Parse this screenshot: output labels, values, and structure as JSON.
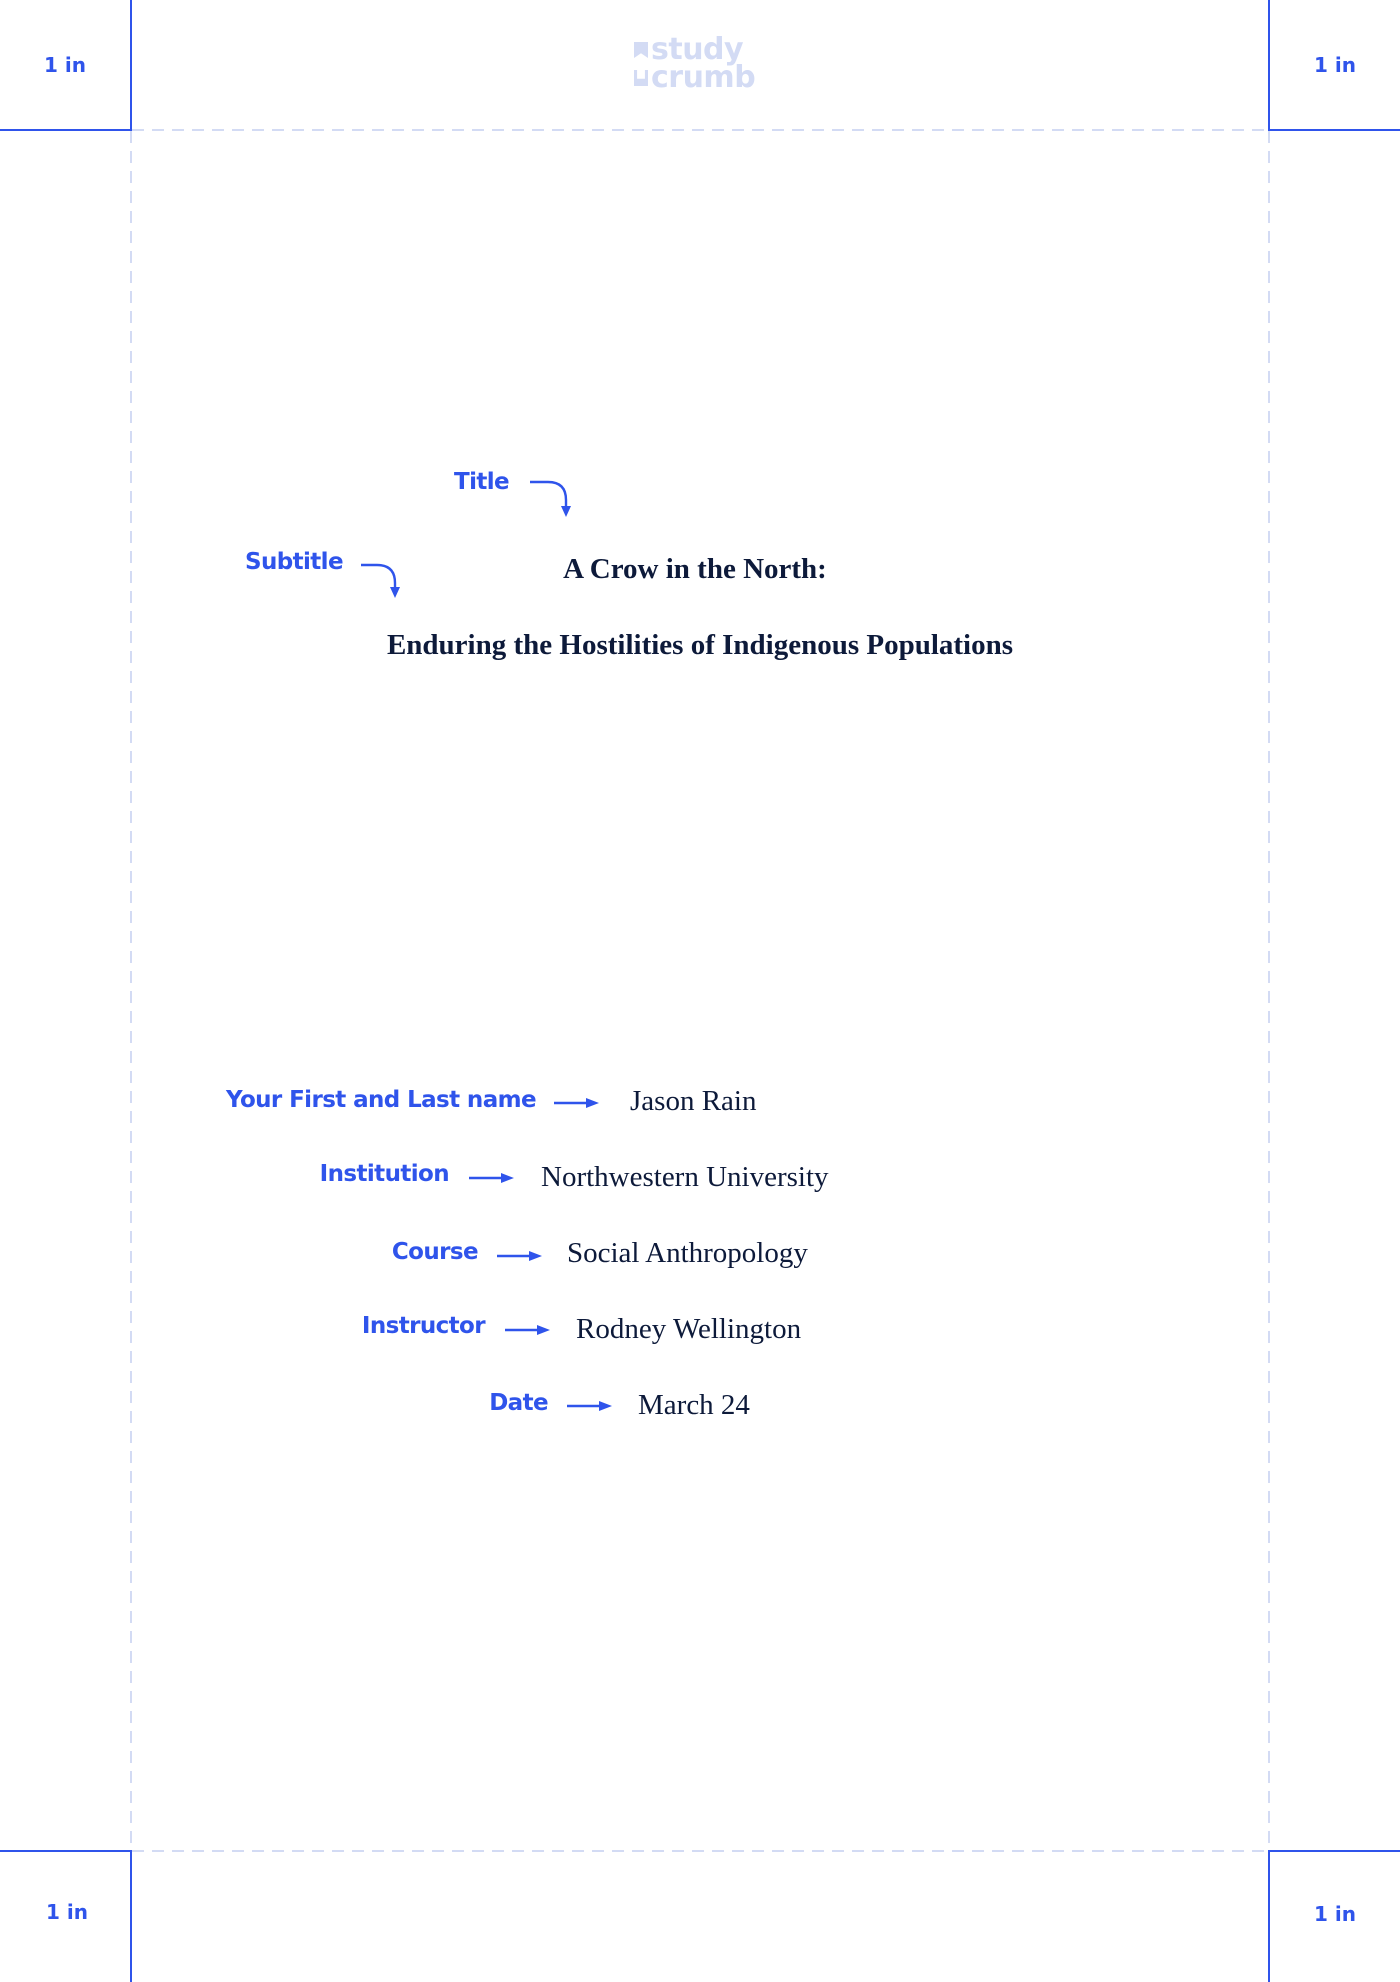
{
  "brand": {
    "logo_line1": "study",
    "logo_line2": "crumb",
    "accent_color": "#2f54eb",
    "guide_color": "#d3dbf4",
    "text_color": "#0d1a3a"
  },
  "margins": {
    "top_left": "1 in",
    "top_right": "1 in",
    "bottom_left": "1 in",
    "bottom_right": "1 in"
  },
  "annotations": {
    "title": "Title",
    "subtitle": "Subtitle",
    "name": "Your First and Last name",
    "institution": "Institution",
    "course": "Course",
    "instructor": "Instructor",
    "date": "Date"
  },
  "document": {
    "title": "A Crow in the North:",
    "subtitle": "Enduring the Hostilities of Indigenous Populations",
    "author": "Jason Rain",
    "institution": "Northwestern University",
    "course": "Social Anthropology",
    "instructor": "Rodney Wellington",
    "date": "March 24"
  }
}
